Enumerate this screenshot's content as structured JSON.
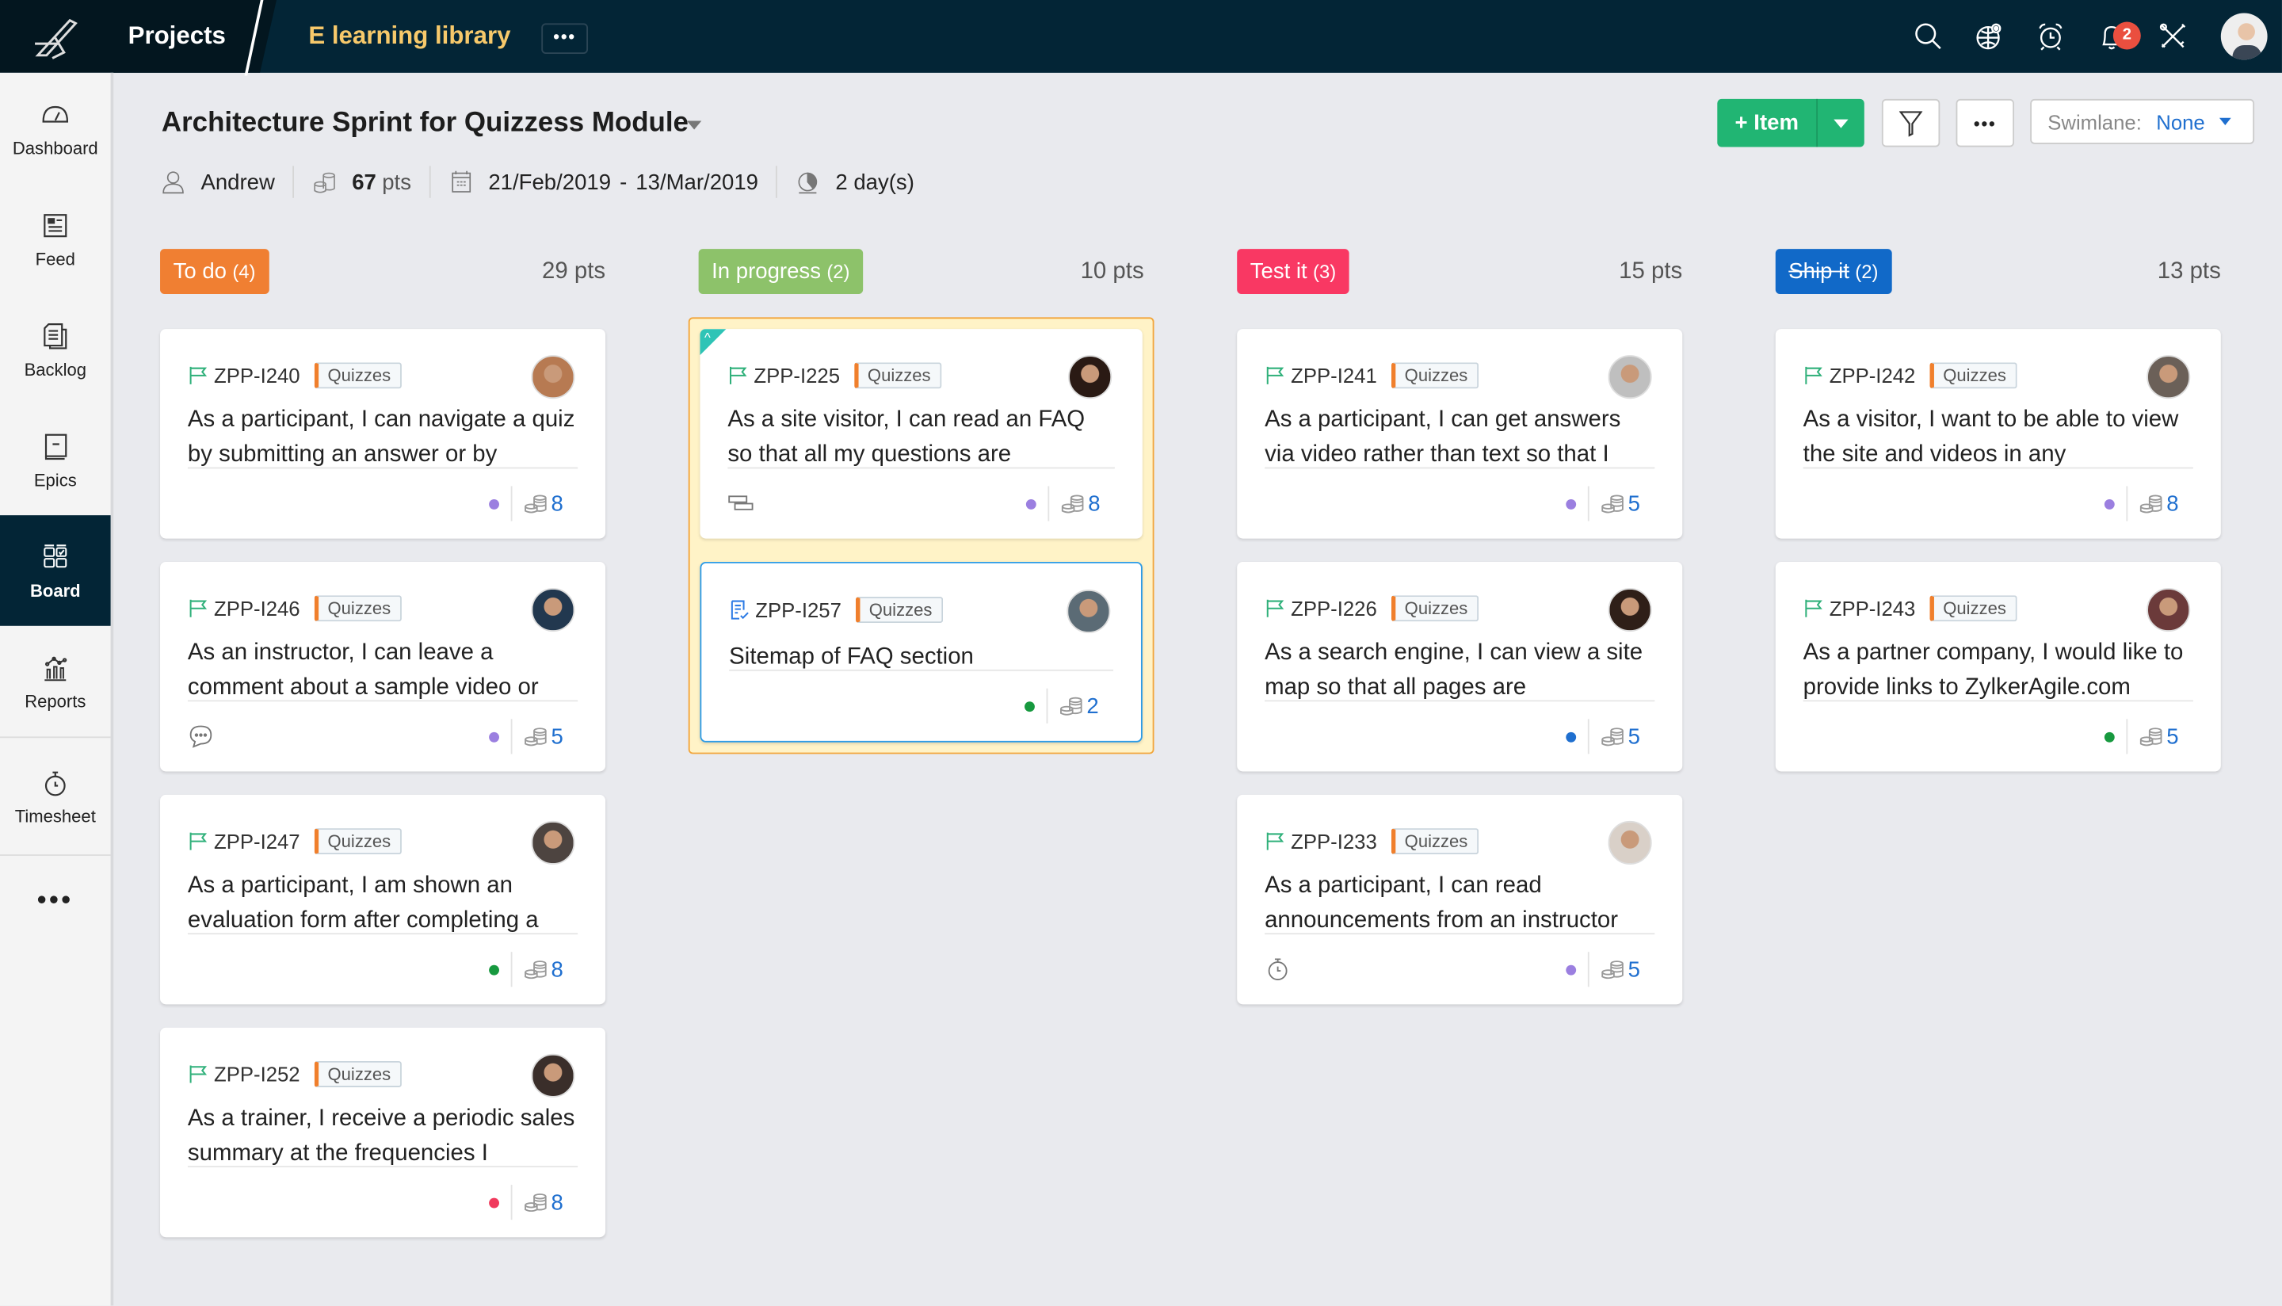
{
  "topbar": {
    "projects_label": "Projects",
    "project_name": "E learning library",
    "more_label": "•••",
    "icons": [
      "search-icon",
      "global-view-icon",
      "alarm-clock-icon",
      "bell-icon",
      "tools-icon"
    ],
    "notification_count": "2"
  },
  "sidebar": {
    "items": [
      {
        "label": "Dashboard",
        "icon": "dashboard-gauge-icon"
      },
      {
        "label": "Feed",
        "icon": "feed-newspaper-icon"
      },
      {
        "label": "Backlog",
        "icon": "backlog-documents-icon"
      },
      {
        "label": "Epics",
        "icon": "epics-book-icon"
      },
      {
        "label": "Board",
        "icon": "board-grid-icon",
        "active": true
      },
      {
        "label": "Reports",
        "icon": "reports-chart-icon"
      },
      {
        "label": "Timesheet",
        "icon": "stopwatch-icon"
      }
    ],
    "more_label": "•••"
  },
  "sprint": {
    "title": "Architecture Sprint for Quizzess Module",
    "owner": "Andrew",
    "points_value": "67",
    "points_unit": "pts",
    "start_date": "21/Feb/2019",
    "date_sep": "-",
    "end_date": "13/Mar/2019",
    "duration": "2 day(s)"
  },
  "toolbar": {
    "add_item_label": "+ Item",
    "more_label": "•••",
    "swimlane_label": "Swimlane:",
    "swimlane_value": "None"
  },
  "columns": [
    {
      "status": "To do",
      "count": "(4)",
      "points": "29 pts",
      "color": "#f07f32",
      "cards": [
        {
          "id": "ZPP-I240",
          "tag": "Quizzes",
          "text": "As a participant, I can navigate a quiz by submitting an answer or by",
          "priority_color": "#9b7fe0",
          "estimate": "8",
          "foot_icon": ""
        },
        {
          "id": "ZPP-I246",
          "tag": "Quizzes",
          "text": "As an instructor, I can leave a comment about a sample video or",
          "priority_color": "#9b7fe0",
          "estimate": "5",
          "foot_icon": "comment-icon"
        },
        {
          "id": "ZPP-I247",
          "tag": "Quizzes",
          "text": "As a participant, I am shown an evaluation form after completing a",
          "priority_color": "#17993f",
          "estimate": "8",
          "foot_icon": ""
        },
        {
          "id": "ZPP-I252",
          "tag": "Quizzes",
          "text": "As a trainer, I receive a periodic sales summary at the frequencies I",
          "priority_color": "#f0395c",
          "estimate": "8",
          "foot_icon": ""
        }
      ]
    },
    {
      "status": "In progress",
      "count": "(2)",
      "points": "10 pts",
      "color": "#8dc26a",
      "cards": [
        {
          "id": "ZPP-I225",
          "tag": "Quizzes",
          "text": "As a site visitor, I can read an FAQ so that all my questions are",
          "priority_color": "#9b7fe0",
          "estimate": "8",
          "foot_icon": "subtasks-icon"
        },
        {
          "id": "ZPP-I257",
          "tag": "Quizzes",
          "text": "Sitemap of FAQ section",
          "priority_color": "#17993f",
          "estimate": "2",
          "foot_icon": ""
        }
      ]
    },
    {
      "status": "Test it",
      "count": "(3)",
      "points": "15 pts",
      "color": "#f93863",
      "cards": [
        {
          "id": "ZPP-I241",
          "tag": "Quizzes",
          "text": "As a participant, I can get answers via video rather than text so that I",
          "priority_color": "#9b7fe0",
          "estimate": "5",
          "foot_icon": ""
        },
        {
          "id": "ZPP-I226",
          "tag": "Quizzes",
          "text": "As a search engine, I can view a site map so that all pages are",
          "priority_color": "#1f6fcf",
          "estimate": "5",
          "foot_icon": ""
        },
        {
          "id": "ZPP-I233",
          "tag": "Quizzes",
          "text": "As a participant, I can read announcements from an instructor",
          "priority_color": "#9b7fe0",
          "estimate": "5",
          "foot_icon": "timer-icon"
        }
      ]
    },
    {
      "status": "Ship it",
      "count": "(2)",
      "points": "13 pts",
      "color": "#1169c8",
      "cards": [
        {
          "id": "ZPP-I242",
          "tag": "Quizzes",
          "text": "As a visitor, I want to be able to view the site and videos in any",
          "priority_color": "#9b7fe0",
          "estimate": "8",
          "foot_icon": ""
        },
        {
          "id": "ZPP-I243",
          "tag": "Quizzes",
          "text": "As a partner company, I would like to provide links to ZylkerAgile.com",
          "priority_color": "#17993f",
          "estimate": "5",
          "foot_icon": ""
        }
      ]
    }
  ],
  "colors": {
    "topbar": "#032536",
    "accent_green": "#21b573",
    "link_blue": "#1f6fcf",
    "project_name": "#f7c96b"
  }
}
